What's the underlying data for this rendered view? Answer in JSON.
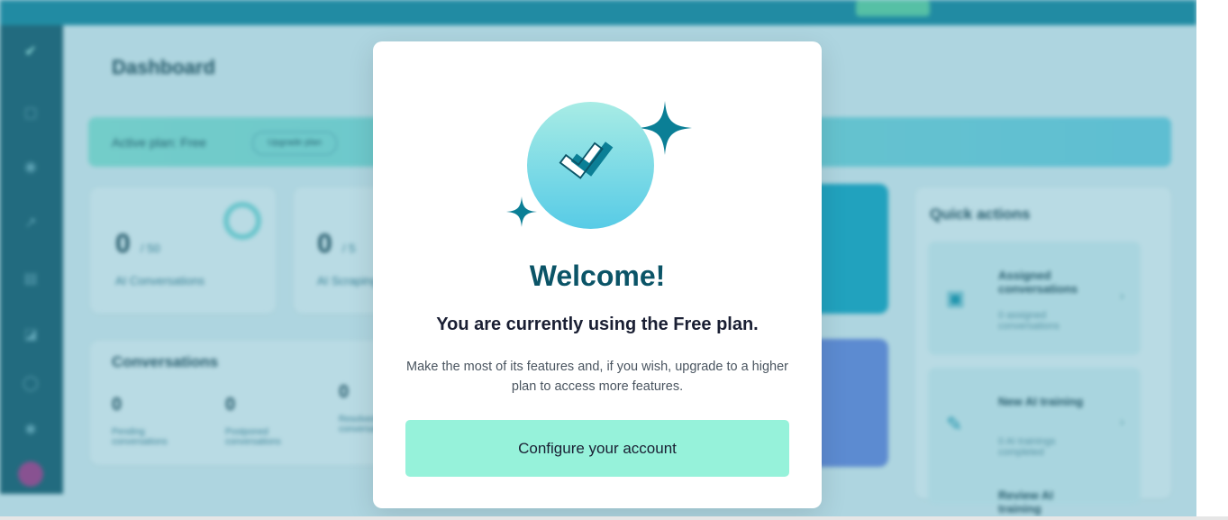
{
  "topbar": {
    "banner_text": "",
    "banner_button": ""
  },
  "dashboard": {
    "title": "Dashboard",
    "plan_bar": {
      "text": "Active plan: Free",
      "upgrade_label": "Upgrade plan"
    },
    "stat_cards": [
      {
        "value": "0",
        "suffix": "/ 50",
        "label": "AI Conversations"
      },
      {
        "value": "0",
        "suffix": "/ 5",
        "label": "AI Scraping"
      }
    ],
    "conversations": {
      "title": "Conversations",
      "items": [
        {
          "value": "0",
          "label": "Pending conversations"
        },
        {
          "value": "0",
          "label": "Postponed conversations"
        },
        {
          "value": "0",
          "label": "Resolved conversations"
        }
      ]
    },
    "quick_actions": {
      "title": "Quick actions",
      "items": [
        {
          "title": "Assigned conversations",
          "sub": "0 assigned conversations"
        },
        {
          "title": "New AI training",
          "sub": "0 AI trainings completed"
        },
        {
          "title": "Review AI training",
          "sub": ""
        }
      ]
    }
  },
  "modal": {
    "title": "Welcome!",
    "subtitle": "You are currently using the Free plan.",
    "description": "Make the most of its features and, if you wish, upgrade to a higher plan to access more features.",
    "cta_label": "Configure your account"
  },
  "colors": {
    "brand_dark": "#0b5467",
    "cta_bg": "#96f2da",
    "overlay": "rgba(70,160,185,0.38)",
    "topbar": "#0b7f96",
    "sidebar": "#0c4b5c"
  },
  "icons": {
    "logo": "double-check-logo-icon",
    "sparkle": "sparkle-icon"
  }
}
